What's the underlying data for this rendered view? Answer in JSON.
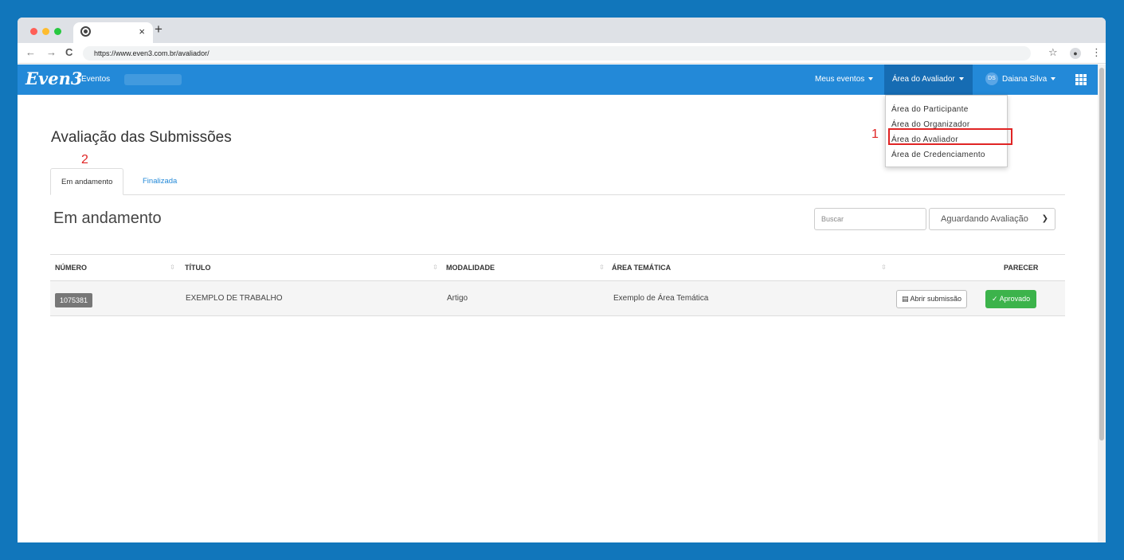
{
  "browser": {
    "new_tab": "+",
    "close_tab": "×",
    "url": "https://www.even3.com.br/avaliador/",
    "nav": {
      "back": "←",
      "forward": "→",
      "reload": "C"
    },
    "bookmark": "☆",
    "menu": "⋮"
  },
  "app": {
    "logo": "Even3",
    "logo_sub": "Eventos",
    "nav": {
      "meus_eventos": "Meus eventos",
      "area_avaliador": "Área do Avaliador",
      "user_initials": "DS",
      "user_name": "Daiana Silva"
    },
    "dropdown": [
      "Área do Participante",
      "Área do Organizador",
      "Área do Avaliador",
      "Área de Credenciamento"
    ]
  },
  "annotations": {
    "one": "1",
    "two": "2"
  },
  "page": {
    "title": "Avaliação das Submissões",
    "tabs": [
      "Em andamento",
      "Finalizada"
    ],
    "section_title": "Em andamento",
    "search_placeholder": "Buscar",
    "filter_selected": "Aguardando Avaliação",
    "table": {
      "headers": [
        "NÚMERO",
        "TÍTULO",
        "MODALIDADE",
        "ÁREA TEMÁTICA",
        "",
        "PARECER"
      ],
      "rows": [
        {
          "numero": "1075381",
          "titulo": "EXEMPLO DE TRABALHO",
          "modalidade": "Artigo",
          "area": "Exemplo de Área Temática",
          "open_label": "Abrir submissão",
          "parecer": "Aprovado"
        }
      ]
    }
  },
  "colors": {
    "background": "#1176bb",
    "navbar": "#2389d8",
    "navbar_active": "#166cb3",
    "approved": "#3cb34b",
    "annotation": "#e02424"
  }
}
